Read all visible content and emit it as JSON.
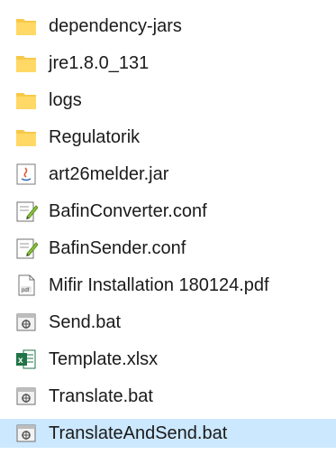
{
  "explorer": {
    "files": [
      {
        "name": "dependency-jars",
        "icon": "folder-icon",
        "type": "folder"
      },
      {
        "name": "jre1.8.0_131",
        "icon": "folder-icon",
        "type": "folder"
      },
      {
        "name": "logs",
        "icon": "folder-icon",
        "type": "folder"
      },
      {
        "name": "Regulatorik",
        "icon": "folder-icon",
        "type": "folder"
      },
      {
        "name": "art26melder.jar",
        "icon": "java-jar-icon",
        "type": "jar"
      },
      {
        "name": "BafinConverter.conf",
        "icon": "config-file-icon",
        "type": "conf"
      },
      {
        "name": "BafinSender.conf",
        "icon": "config-file-icon",
        "type": "conf"
      },
      {
        "name": "Mifir Installation 180124.pdf",
        "icon": "pdf-file-icon",
        "type": "pdf"
      },
      {
        "name": "Send.bat",
        "icon": "batch-file-icon",
        "type": "bat"
      },
      {
        "name": "Template.xlsx",
        "icon": "excel-file-icon",
        "type": "xlsx"
      },
      {
        "name": "Translate.bat",
        "icon": "batch-file-icon",
        "type": "bat"
      },
      {
        "name": "TranslateAndSend.bat",
        "icon": "batch-file-icon",
        "type": "bat",
        "selected": true
      }
    ]
  },
  "colors": {
    "folder": "#f7c948",
    "selection": "#cce8ff",
    "excel": "#217346"
  }
}
